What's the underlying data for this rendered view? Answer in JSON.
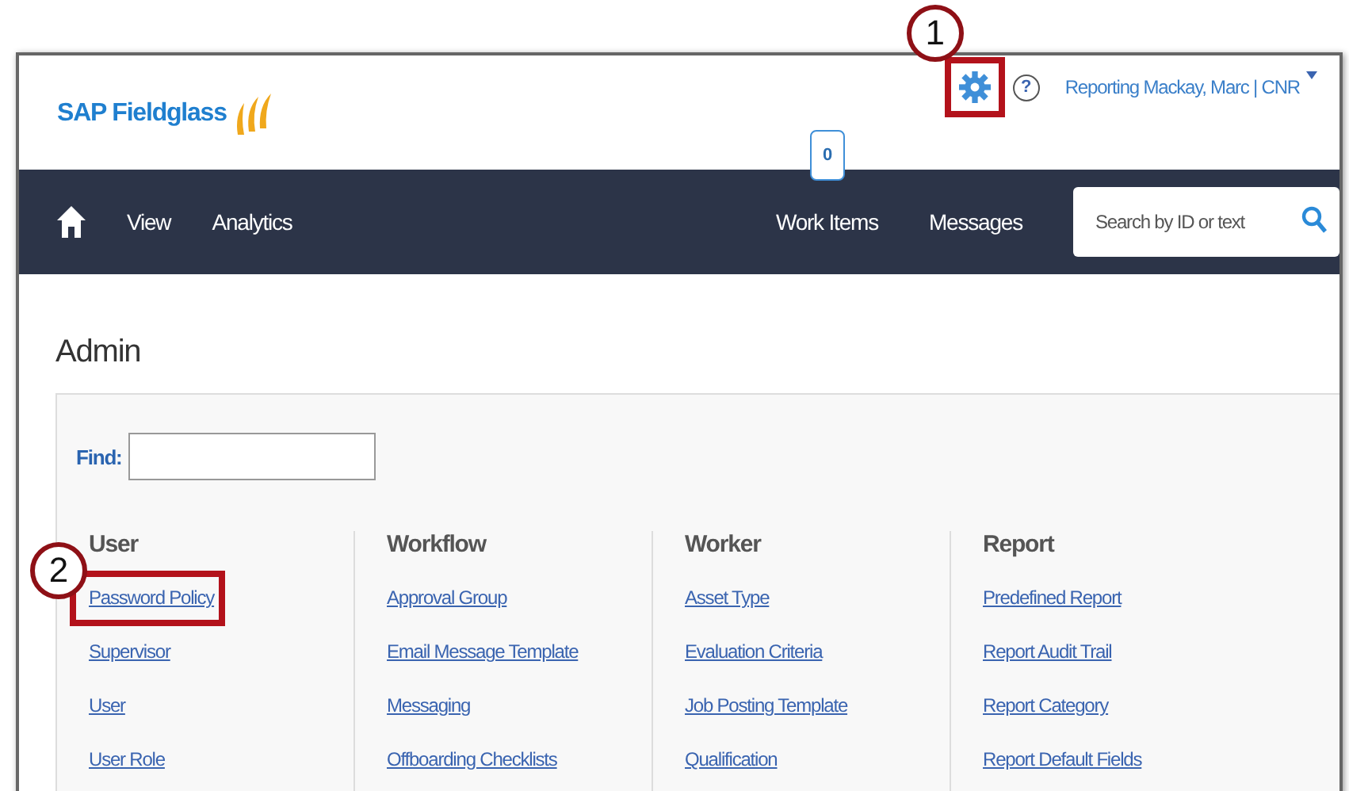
{
  "header": {
    "brand": "SAP Fieldglass",
    "help": "?",
    "user_menu": "Reporting Mackay, Marc | CNR"
  },
  "nav": {
    "left_items": [
      {
        "label": "View"
      },
      {
        "label": "Analytics"
      }
    ],
    "right_items": [
      {
        "label": "Work Items",
        "badge": "0"
      },
      {
        "label": "Messages"
      }
    ],
    "search": {
      "placeholder": "Search by ID or text"
    }
  },
  "page_title": "Admin",
  "find": {
    "label": "Find:"
  },
  "columns": [
    {
      "heading": "User",
      "links": [
        "Password Policy",
        "Supervisor",
        "User",
        "User Role"
      ]
    },
    {
      "heading": "Workflow",
      "links": [
        "Approval Group",
        "Email Message Template",
        "Messaging",
        "Offboarding Checklists"
      ]
    },
    {
      "heading": "Worker",
      "links": [
        "Asset Type",
        "Evaluation Criteria",
        "Job Posting Template",
        "Qualification"
      ]
    },
    {
      "heading": "Report",
      "links": [
        "Predefined Report",
        "Report Audit Trail",
        "Report Category",
        "Report Default Fields"
      ]
    }
  ],
  "callouts": [
    {
      "label": "1"
    },
    {
      "label": "2"
    }
  ]
}
